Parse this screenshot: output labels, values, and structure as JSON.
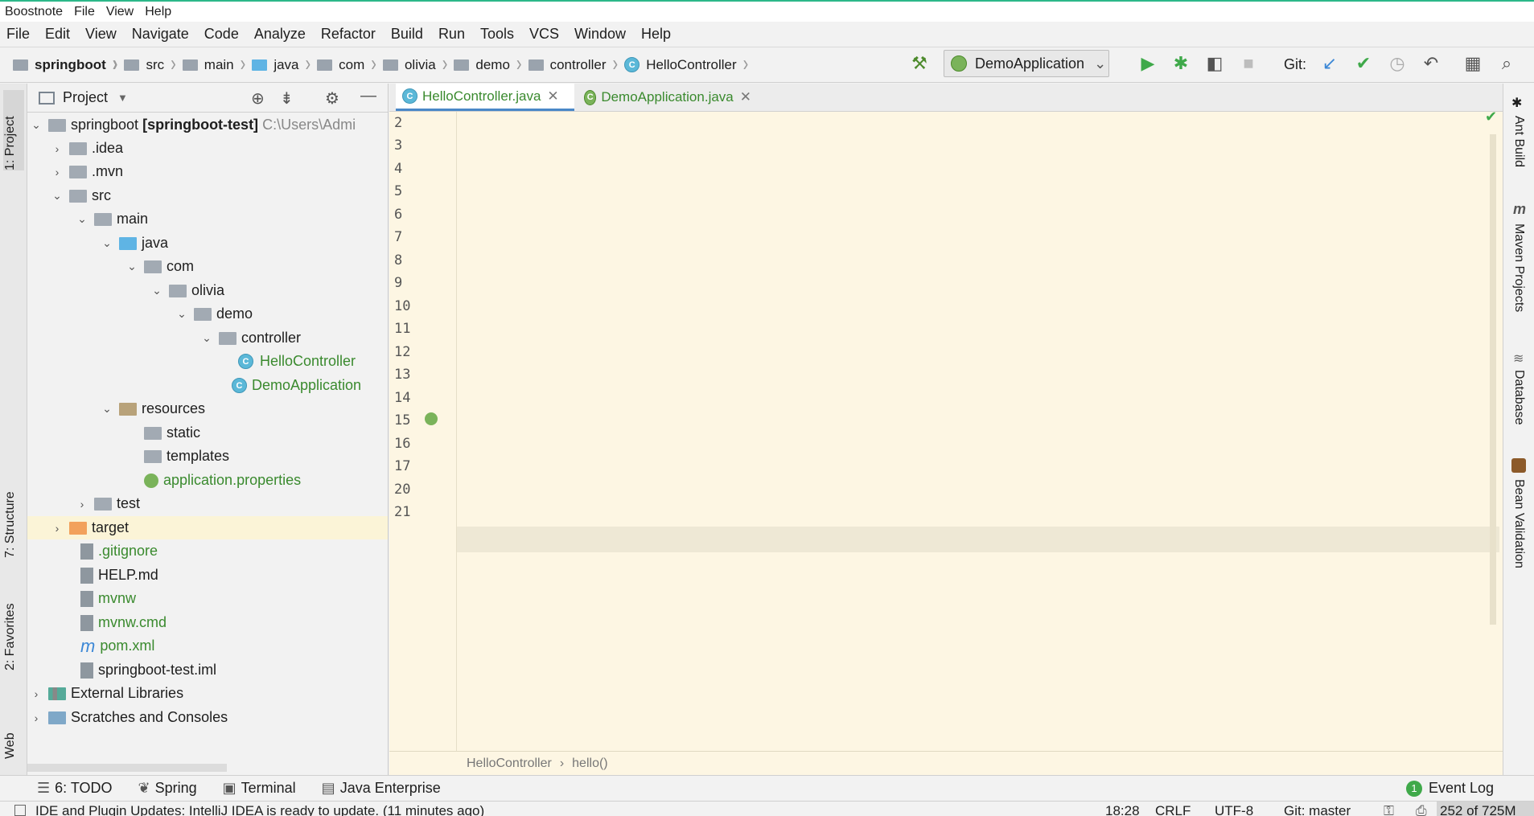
{
  "os_menu": [
    "Boostnote",
    "File",
    "View",
    "Help"
  ],
  "app_menu": [
    "File",
    "Edit",
    "View",
    "Navigate",
    "Code",
    "Analyze",
    "Refactor",
    "Build",
    "Run",
    "Tools",
    "VCS",
    "Window",
    "Help"
  ],
  "breadcrumbs": [
    "springboot",
    "src",
    "main",
    "java",
    "com",
    "olivia",
    "demo",
    "controller",
    "HelloController"
  ],
  "toolbar": {
    "run_config": "DemoApplication",
    "git_label": "Git:"
  },
  "project_panel": {
    "title": "Project",
    "tree": [
      {
        "label": "springboot",
        "suffix": "[springboot-test]",
        "path": "C:\\Users\\Admi"
      },
      {
        "label": ".idea"
      },
      {
        "label": ".mvn"
      },
      {
        "label": "src"
      },
      {
        "label": "main"
      },
      {
        "label": "java"
      },
      {
        "label": "com"
      },
      {
        "label": "olivia"
      },
      {
        "label": "demo"
      },
      {
        "label": "controller"
      },
      {
        "label": "HelloController"
      },
      {
        "label": "DemoApplication"
      },
      {
        "label": "resources"
      },
      {
        "label": "static"
      },
      {
        "label": "templates"
      },
      {
        "label": "application.properties"
      },
      {
        "label": "test"
      },
      {
        "label": "target"
      },
      {
        "label": ".gitignore"
      },
      {
        "label": "HELP.md"
      },
      {
        "label": "mvnw"
      },
      {
        "label": "mvnw.cmd"
      },
      {
        "label": "pom.xml"
      },
      {
        "label": "springboot-test.iml"
      },
      {
        "label": "External Libraries"
      },
      {
        "label": "Scratches and Consoles"
      }
    ]
  },
  "editor_tabs": [
    {
      "label": "HelloController.java",
      "active": true
    },
    {
      "label": "DemoApplication.java",
      "active": false
    }
  ],
  "line_numbers": [
    "2",
    "3",
    "4",
    "5",
    "6",
    "7",
    "8",
    "9",
    "10",
    "11",
    "12",
    "13",
    "14",
    "15",
    "16",
    "17",
    "20",
    "21"
  ],
  "editor_breadcrumb": {
    "class": "HelloController",
    "method": "hello()"
  },
  "left_tool_tabs": [
    "1: Project",
    "7: Structure",
    "2: Favorites",
    "Web"
  ],
  "right_tool_tabs": [
    "Ant Build",
    "Maven Projects",
    "Database",
    "Bean Validation"
  ],
  "bottom_tabs": [
    "6: TODO",
    "Spring",
    "Terminal",
    "Java Enterprise",
    "Event Log"
  ],
  "status_bar": {
    "message": "IDE and Plugin Updates: IntelliJ IDEA is ready to update. (11 minutes ago)",
    "position": "18:28",
    "line_sep": "CRLF",
    "encoding": "UTF-8",
    "git": "Git: master",
    "memory": "252 of 725M"
  },
  "colors": {
    "editor_bg": "#fdf6e3",
    "accent": "#4a88c7",
    "selected_row": "#fbf4d7"
  }
}
